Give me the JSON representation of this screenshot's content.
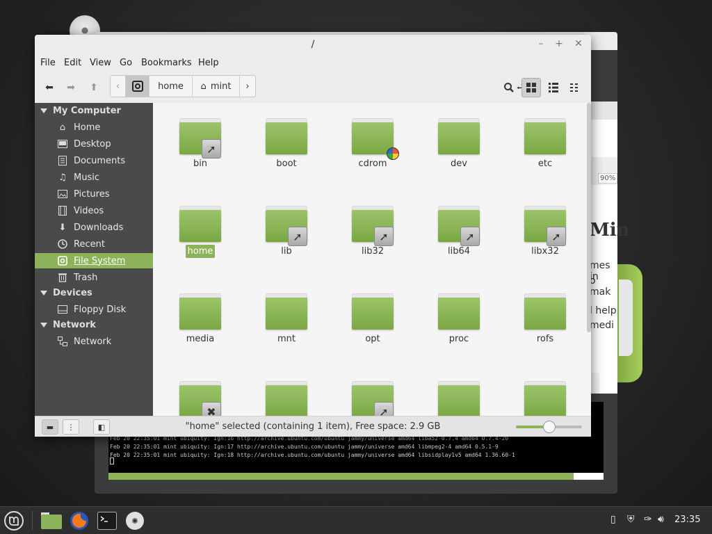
{
  "colors": {
    "accent": "#8cb35a",
    "sidebar_bg": "#4a4a4a",
    "content_bg": "#f5f5f5"
  },
  "window": {
    "title": "/"
  },
  "menu": [
    "File",
    "Edit",
    "View",
    "Go",
    "Bookmarks",
    "Help"
  ],
  "pathbar": {
    "segments": [
      {
        "label": "home",
        "icon": ""
      },
      {
        "label": "mint",
        "icon": "home-icon"
      }
    ]
  },
  "sidebar": {
    "sections": [
      {
        "title": "My Computer",
        "items": [
          {
            "label": "Home",
            "icon": "home-icon"
          },
          {
            "label": "Desktop",
            "icon": "desktop-icon"
          },
          {
            "label": "Documents",
            "icon": "documents-icon"
          },
          {
            "label": "Music",
            "icon": "music-icon"
          },
          {
            "label": "Pictures",
            "icon": "pictures-icon"
          },
          {
            "label": "Videos",
            "icon": "videos-icon"
          },
          {
            "label": "Downloads",
            "icon": "downloads-icon"
          },
          {
            "label": "Recent",
            "icon": "recent-icon"
          },
          {
            "label": "File System",
            "icon": "filesystem-icon",
            "selected": true
          },
          {
            "label": "Trash",
            "icon": "trash-icon"
          }
        ]
      },
      {
        "title": "Devices",
        "items": [
          {
            "label": "Floppy Disk",
            "icon": "floppy-icon"
          }
        ]
      },
      {
        "title": "Network",
        "items": [
          {
            "label": "Network",
            "icon": "network-icon"
          }
        ]
      }
    ]
  },
  "files": [
    {
      "name": "bin",
      "emblem": "symlink"
    },
    {
      "name": "boot",
      "emblem": ""
    },
    {
      "name": "cdrom",
      "emblem": "no-access"
    },
    {
      "name": "dev",
      "emblem": ""
    },
    {
      "name": "etc",
      "emblem": ""
    },
    {
      "name": "home",
      "emblem": "",
      "selected": true
    },
    {
      "name": "lib",
      "emblem": "symlink"
    },
    {
      "name": "lib32",
      "emblem": "symlink"
    },
    {
      "name": "lib64",
      "emblem": "symlink"
    },
    {
      "name": "libx32",
      "emblem": "symlink"
    },
    {
      "name": "media",
      "emblem": ""
    },
    {
      "name": "mnt",
      "emblem": ""
    },
    {
      "name": "opt",
      "emblem": ""
    },
    {
      "name": "proc",
      "emblem": ""
    },
    {
      "name": "rofs",
      "emblem": ""
    },
    {
      "name": "",
      "emblem": "unreadable"
    },
    {
      "name": "",
      "emblem": ""
    },
    {
      "name": "",
      "emblem": "symlink"
    },
    {
      "name": "",
      "emblem": ""
    },
    {
      "name": "",
      "emblem": ""
    }
  ],
  "statusbar": {
    "text": "\"home\" selected (containing 1 item), Free space: 2.9 GB",
    "zoom_fraction": 0.5
  },
  "installer": {
    "zoom": "90%",
    "heading": "Min",
    "text_lines": [
      "mes in",
      "o mak",
      "l help",
      "medi"
    ],
    "terminal_lines": [
      "Feb 20 22:35:01 mint ubiquity: Ign:16 http://archive.ubuntu.com/ubuntu jammy/universe amd64 liba52-0.7.4 amd64 0.7.4-20",
      "Feb 20 22:35:01 mint ubiquity: Ign:17 http://archive.ubuntu.com/ubuntu jammy/universe amd64 libmpeg2-4 amd64 0.5.1-9",
      "Feb 20 22:35:01 mint ubiquity: Ign:18 http://archive.ubuntu.com/ubuntu jammy/universe amd64 libsidplay1v5 amd64 1.36.60-1"
    ],
    "progress_fraction": 0.94
  },
  "taskbar": {
    "clock": "23:35"
  }
}
